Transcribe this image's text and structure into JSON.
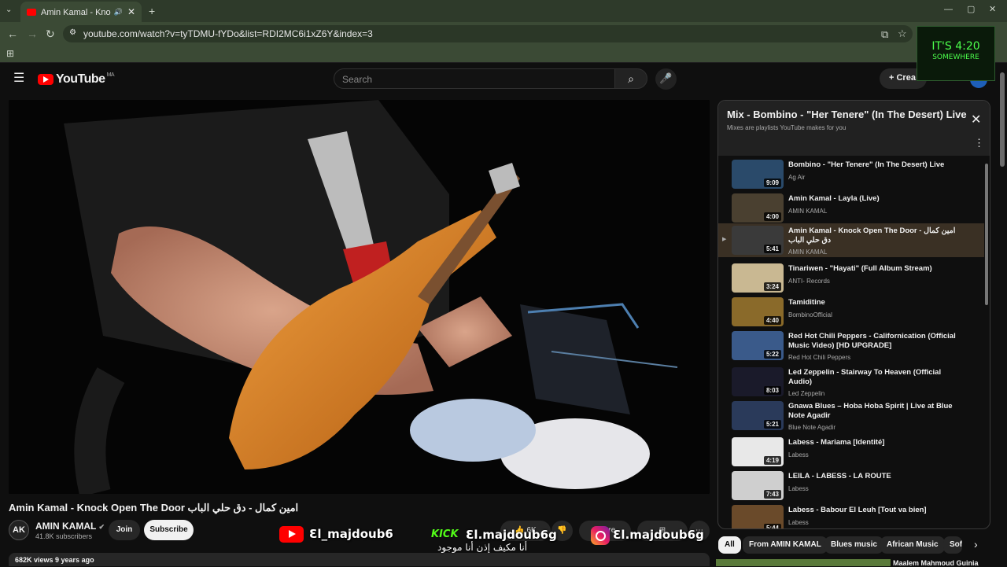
{
  "browser": {
    "tab_title": "Amin Kamal - Knock Open The Door امين كمال - دق",
    "url": "youtube.com/watch?v=tyTDMU-fYDo&list=RDI2MC6i1xZ6Y&index=3"
  },
  "ad": {
    "line1": "IT'S 4:20",
    "line2": "SOMEWHERE"
  },
  "header": {
    "logo_text": "YouTube",
    "region": "MA",
    "search_placeholder": "Search",
    "create_label": "Crea"
  },
  "video": {
    "title": "Amin Kamal - Knock Open The Door امين كمال - دق حلي الباب",
    "channel": "AMIN KAMAL",
    "channel_initials": "AK",
    "subscribers": "41.8K subscribers",
    "join_label": "Join",
    "subscribe_label": "Subscribe",
    "stats": "682K views  9 years ago",
    "like_count": "6K",
    "share_label": "Share"
  },
  "overlay": {
    "youtube_handle": "Ɛl_majdoub6",
    "kick_label": "KICK",
    "kick_handle": "Ɛl.majdoub6g",
    "ig_handle": "Ɛl.majdoub6g",
    "arabic_caption": "أنا مكيف إذن أنا موجود"
  },
  "playlist": {
    "title": "Mix - Bombino - \"Her Tenere\" (In The Desert) Live",
    "subtitle": "Mixes are playlists YouTube makes for you",
    "items": [
      {
        "title": "Bombino - \"Her Tenere\" (In The Desert) Live",
        "channel": "Ag Air",
        "duration": "9:09",
        "color": "#2a4a6a"
      },
      {
        "title": "Amin Kamal - Layla (Live)",
        "channel": "AMIN KAMAL",
        "duration": "4:00",
        "color": "#4a4030"
      },
      {
        "title": "Amin Kamal - Knock Open The Door امين كمال - دق حلي الباب",
        "channel": "AMIN KAMAL",
        "duration": "5:41",
        "color": "#3a3a3a"
      },
      {
        "title": "Tinariwen - \"Hayati\" (Full Album Stream)",
        "channel": "ANTI- Records",
        "duration": "3:24",
        "color": "#c9b892"
      },
      {
        "title": "Tamiditine",
        "channel": "BombinoOfficial",
        "duration": "4:40",
        "color": "#8a6a2a"
      },
      {
        "title": "Red Hot Chili Peppers - Californication (Official Music Video) [HD UPGRADE]",
        "channel": "Red Hot Chili Peppers",
        "duration": "5:22",
        "color": "#3a5a8a"
      },
      {
        "title": "Led Zeppelin - Stairway To Heaven (Official Audio)",
        "channel": "Led Zeppelin",
        "duration": "8:03",
        "color": "#1a1a2a"
      },
      {
        "title": "Gnawa Blues – Hoba Hoba Spirit | Live at Blue Note Agadir",
        "channel": "Blue Note Agadir",
        "duration": "5:21",
        "color": "#2a3a5a"
      },
      {
        "title": "Labess - Mariama [Identité]",
        "channel": "Labess",
        "duration": "4:19",
        "color": "#e8e8e8"
      },
      {
        "title": "LEILA - LABESS - LA ROUTE",
        "channel": "Labess",
        "duration": "7:43",
        "color": "#cfcfcf"
      },
      {
        "title": "Labess - Babour El Leuh [Tout va bien]",
        "channel": "Labess",
        "duration": "5:44",
        "color": "#6a4a2a"
      }
    ]
  },
  "chips": [
    "All",
    "From AMIN KAMAL",
    "Blues music",
    "African Music",
    "Sof"
  ],
  "next_video": {
    "title": "Maalem Mahmoud Guinia"
  }
}
